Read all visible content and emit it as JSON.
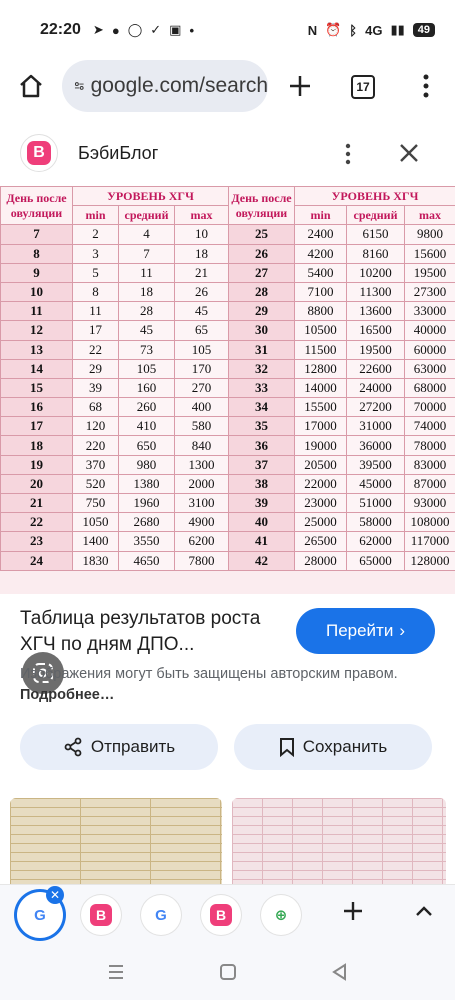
{
  "status_bar": {
    "time": "22:20",
    "left_icons": [
      "telegram-icon",
      "chat-bubble-icon",
      "cloud-icon",
      "check-circle-icon",
      "lock-icon",
      "dot-icon"
    ],
    "right_icons": [
      "nfc-icon",
      "alarm-icon",
      "bluetooth-icon",
      "signal-icon"
    ],
    "network": "4G",
    "battery": "49"
  },
  "browser": {
    "url": "google.com/search",
    "tab_count": "17"
  },
  "sheet": {
    "site_name": "БэбиБлог",
    "site_logo_letter": "B"
  },
  "table": {
    "headers": {
      "day": "День после овуляции",
      "level": "УРОВЕНЬ ХГЧ",
      "min": "min",
      "avg": "средний",
      "max": "max"
    },
    "left": [
      [
        "7",
        "2",
        "4",
        "10"
      ],
      [
        "8",
        "3",
        "7",
        "18"
      ],
      [
        "9",
        "5",
        "11",
        "21"
      ],
      [
        "10",
        "8",
        "18",
        "26"
      ],
      [
        "11",
        "11",
        "28",
        "45"
      ],
      [
        "12",
        "17",
        "45",
        "65"
      ],
      [
        "13",
        "22",
        "73",
        "105"
      ],
      [
        "14",
        "29",
        "105",
        "170"
      ],
      [
        "15",
        "39",
        "160",
        "270"
      ],
      [
        "16",
        "68",
        "260",
        "400"
      ],
      [
        "17",
        "120",
        "410",
        "580"
      ],
      [
        "18",
        "220",
        "650",
        "840"
      ],
      [
        "19",
        "370",
        "980",
        "1300"
      ],
      [
        "20",
        "520",
        "1380",
        "2000"
      ],
      [
        "21",
        "750",
        "1960",
        "3100"
      ],
      [
        "22",
        "1050",
        "2680",
        "4900"
      ],
      [
        "23",
        "1400",
        "3550",
        "6200"
      ],
      [
        "24",
        "1830",
        "4650",
        "7800"
      ]
    ],
    "right": [
      [
        "25",
        "2400",
        "6150",
        "9800"
      ],
      [
        "26",
        "4200",
        "8160",
        "15600"
      ],
      [
        "27",
        "5400",
        "10200",
        "19500"
      ],
      [
        "28",
        "7100",
        "11300",
        "27300"
      ],
      [
        "29",
        "8800",
        "13600",
        "33000"
      ],
      [
        "30",
        "10500",
        "16500",
        "40000"
      ],
      [
        "31",
        "11500",
        "19500",
        "60000"
      ],
      [
        "32",
        "12800",
        "22600",
        "63000"
      ],
      [
        "33",
        "14000",
        "24000",
        "68000"
      ],
      [
        "34",
        "15500",
        "27200",
        "70000"
      ],
      [
        "35",
        "17000",
        "31000",
        "74000"
      ],
      [
        "36",
        "19000",
        "36000",
        "78000"
      ],
      [
        "37",
        "20500",
        "39500",
        "83000"
      ],
      [
        "38",
        "22000",
        "45000",
        "87000"
      ],
      [
        "39",
        "23000",
        "51000",
        "93000"
      ],
      [
        "40",
        "25000",
        "58000",
        "108000"
      ],
      [
        "41",
        "26500",
        "62000",
        "117000"
      ],
      [
        "42",
        "28000",
        "65000",
        "128000"
      ]
    ]
  },
  "result": {
    "title": "Таблица результатов роста ХГЧ по дням ДПО...",
    "visit_label": "Перейти",
    "copyright_text": "Изображения могут быть защищены авторским правом.",
    "more_link": "Подробнее…",
    "share_label": "Отправить",
    "save_label": "Сохранить"
  },
  "colors": {
    "accent": "#1a73e8",
    "brand_pink": "#ef3e7a",
    "table_header": "#c2185b",
    "table_bg": "#fdf4f6"
  }
}
